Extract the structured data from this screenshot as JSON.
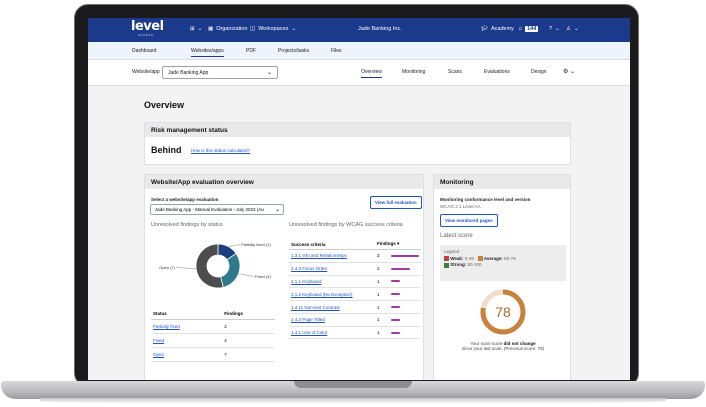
{
  "topbar": {
    "logo": "level",
    "logo_sub": "ACCESS",
    "grid_label": "",
    "organization": "Organization",
    "workspaces": "Workspaces",
    "title": "Jade Banking Inc.",
    "academy": "Academy",
    "notif_count": "144"
  },
  "nav_tabs": [
    "Dashboard",
    "Websites/apps",
    "PDF",
    "Projects/tasks",
    "Files"
  ],
  "app_bar": {
    "label": "Website/app",
    "selected": "Jade Banking App",
    "tabs": [
      "Overview",
      "Monitoring",
      "Scans",
      "Evaluations",
      "Design"
    ]
  },
  "page": {
    "title": "Overview"
  },
  "risk": {
    "heading": "Risk management status",
    "status": "Behind",
    "link": "How is this status calculated?"
  },
  "evaluation": {
    "heading": "Website/App evaluation overview",
    "select_label": "Select a website/app evaluation",
    "select_value": "Jade Banking App - Manual Evaluation - July 2023 (Au",
    "view_report": "View full evaluation",
    "donut_title": "Unresolved findings by status",
    "wcag_title": "Unresolved findings by WCAG success criteria",
    "status_table": {
      "headers": [
        "Status",
        "Findings"
      ],
      "rows": [
        {
          "status": "Partially fixed",
          "count": "2"
        },
        {
          "status": "Fixed",
          "count": "4"
        },
        {
          "status": "Open",
          "count": "7"
        }
      ]
    },
    "wcag_table": {
      "headers": [
        "Success criteria",
        "Findings"
      ],
      "rows": [
        {
          "criteria": "1.3.1 Info and Relationships",
          "count": "3",
          "value": 3
        },
        {
          "criteria": "2.4.3 Focus Order",
          "count": "2",
          "value": 2
        },
        {
          "criteria": "2.1.1 Keyboard",
          "count": "1",
          "value": 1
        },
        {
          "criteria": "2.1.2 Keyboard (No Exception)",
          "count": "1",
          "value": 1
        },
        {
          "criteria": "1.4.11 Non-text Contrast",
          "count": "1",
          "value": 1
        },
        {
          "criteria": "2.4.2 Page Titled",
          "count": "1",
          "value": 1
        },
        {
          "criteria": "1.4.1 Use of Color",
          "count": "1",
          "value": 1
        }
      ]
    }
  },
  "chart_data": {
    "type": "pie",
    "categories": [
      "Partially fixed",
      "Fixed",
      "Open"
    ],
    "values": [
      2,
      4,
      7
    ],
    "labels": [
      "Partially fixed (2)",
      "Fixed (4)",
      "Open (7)"
    ],
    "colors": [
      "#1d3f7e",
      "#2f7a8a",
      "#4d4d4f"
    ]
  },
  "monitoring": {
    "heading": "Monitoring",
    "conf_label": "Monitoring conformance level and version",
    "conf_value": "WCAG 2.1 Level AA",
    "view_pages": "View monitored pages",
    "latest_score": "Latest score",
    "legend_title": "Legend",
    "weak": "Weak:",
    "weak_range": "0-49",
    "average": "Average:",
    "average_range": "50-79",
    "strong": "Strong:",
    "strong_range": "80-100",
    "score": "78",
    "score_value": 78,
    "note_1a": "Your scan score ",
    "note_1b": "did not change",
    "note_2": "since your last scan. (Previous score: 78)",
    "colors": {
      "weak": "#b84343",
      "average": "#c9823d",
      "strong": "#3f7a3a"
    }
  }
}
